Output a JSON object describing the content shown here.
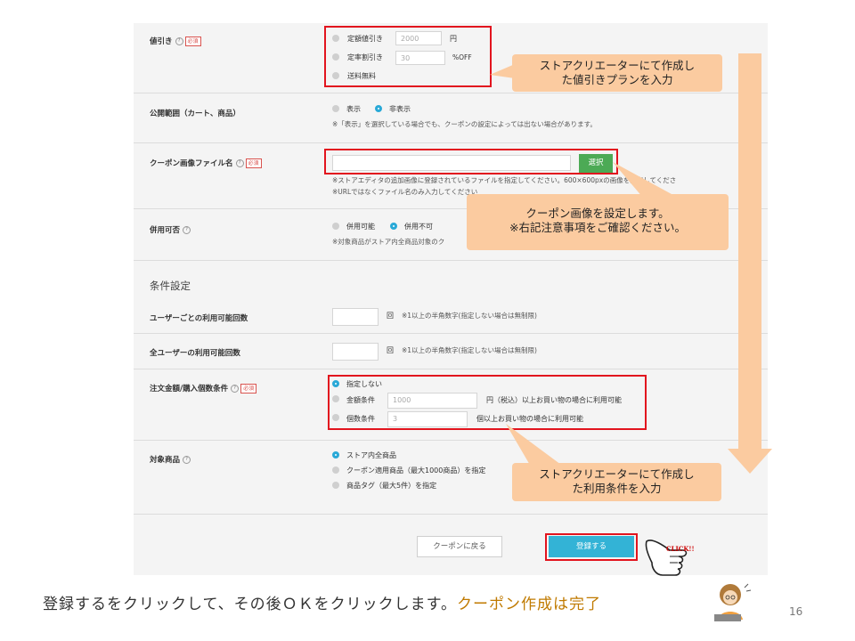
{
  "form": {
    "discount": {
      "label": "値引き",
      "required": "必須",
      "options": [
        {
          "label": "定額値引き",
          "value": "2000",
          "unit": "円"
        },
        {
          "label": "定率割引き",
          "value": "30",
          "unit": "%OFF"
        },
        {
          "label": "送料無料"
        }
      ]
    },
    "visibility": {
      "label": "公開範囲（カート、商品）",
      "options": [
        "表示",
        "非表示"
      ],
      "selected": "非表示",
      "note": "※「表示」を選択している場合でも、クーポンの設定によっては出ない場合があります。"
    },
    "coupon_image": {
      "label": "クーポン画像ファイル名",
      "required": "必須",
      "button": "選択",
      "note1": "※ストアエディタの追加画像に登録されているファイルを指定してください。600×600pxの画像を設定してくださ",
      "note2": "※URLではなくファイル名のみ入力してください"
    },
    "combinable": {
      "label": "併用可否",
      "options": [
        "併用可能",
        "併用不可"
      ],
      "selected": "併用不可",
      "note": "※対象商品がストア内全商品対象のク"
    },
    "conditions_heading": "条件設定",
    "per_user": {
      "label": "ユーザーごとの利用可能回数",
      "unit": "回",
      "note": "※1以上の半角数字(指定しない場合は無制限)"
    },
    "all_users": {
      "label": "全ユーザーの利用可能回数",
      "unit": "回",
      "note": "※1以上の半角数字(指定しない場合は無制限)"
    },
    "order_condition": {
      "label": "注文金額/購入個数条件",
      "required": "必須",
      "options": [
        {
          "label": "指定しない"
        },
        {
          "label": "金額条件",
          "value": "1000",
          "suffix": "円（税込）以上お買い物の場合に利用可能"
        },
        {
          "label": "個数条件",
          "value": "3",
          "suffix": "個以上お買い物の場合に利用可能"
        }
      ],
      "selected": "指定しない"
    },
    "target_products": {
      "label": "対象商品",
      "options": [
        "ストア内全商品",
        "クーポン適用商品（最大1000商品）を指定",
        "商品タグ（最大5件）を指定"
      ],
      "selected": "ストア内全商品"
    },
    "buttons": {
      "back": "クーポンに戻る",
      "submit": "登録する"
    }
  },
  "callouts": {
    "discount": [
      "ストアクリエーターにて作成し",
      "た値引きプランを入力"
    ],
    "image": [
      "クーポン画像を設定します。",
      "※右記注意事項をご確認ください。"
    ],
    "conditions": [
      "ストアクリエーターにて作成し",
      "た利用条件を入力"
    ]
  },
  "click_label": "CLICK!!",
  "caption": {
    "text": "登録するをクリックして、その後ＯＫをクリックします。",
    "highlight": "クーポン作成は完了"
  },
  "page_number": "16",
  "colors": {
    "highlight_red": "#e2141e",
    "callout": "#fbcba0",
    "submit_button": "#33b3d6",
    "select_button": "#4caa55",
    "radio_selected": "#29a9d7"
  }
}
